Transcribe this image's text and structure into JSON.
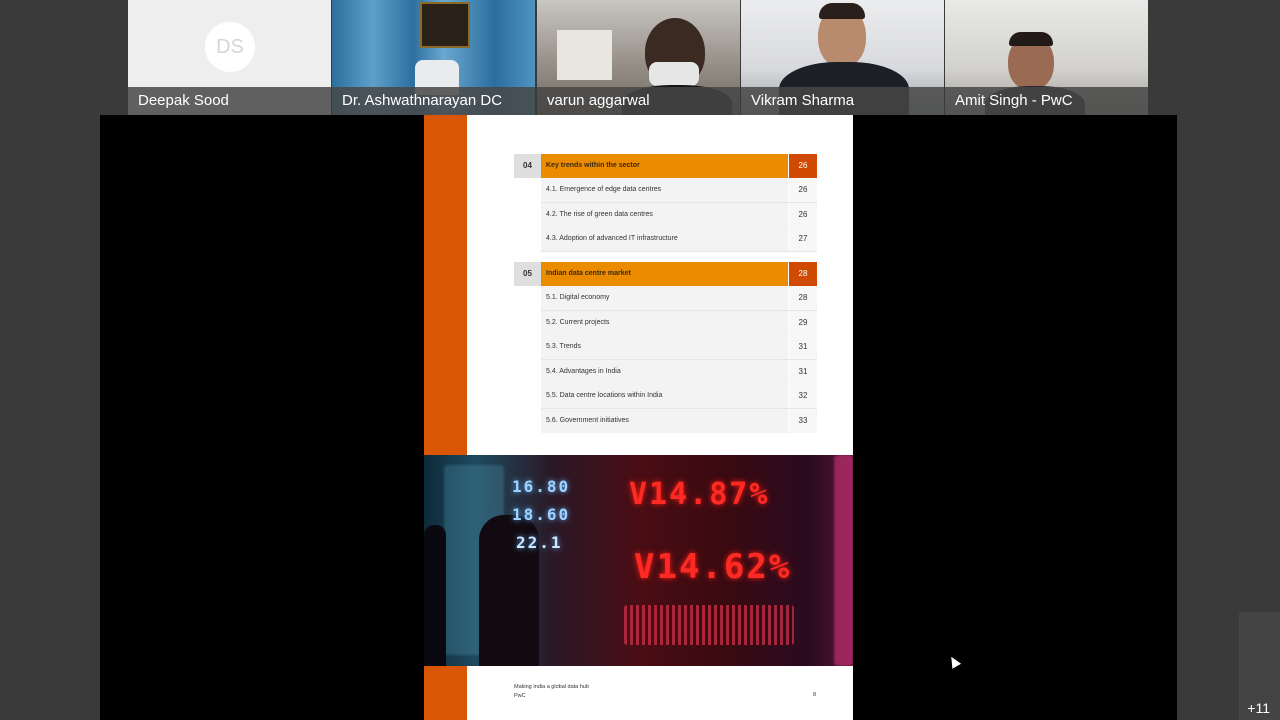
{
  "participants": [
    {
      "name": "Deepak Sood",
      "initials": "DS"
    },
    {
      "name": "Dr. Ashwathnarayan DC"
    },
    {
      "name": "varun aggarwal"
    },
    {
      "name": "Vikram Sharma"
    },
    {
      "name": "Amit Singh - PwC"
    }
  ],
  "overflow_count": "+11",
  "doc": {
    "sections": [
      {
        "num": "04",
        "title": "Key trends within the sector",
        "page": "26",
        "items": [
          {
            "label": "4.1. Emergence of edge data centres",
            "page": "26"
          },
          {
            "label": "4.2. The rise of green data centres",
            "page": "26"
          },
          {
            "label": "4.3. Adoption of advanced IT infrastructure",
            "page": "27"
          }
        ]
      },
      {
        "num": "05",
        "title": "Indian data centre market",
        "page": "28",
        "items": [
          {
            "label": "5.1. Digital economy",
            "page": "28"
          },
          {
            "label": "5.2. Current projects",
            "page": "29"
          },
          {
            "label": "5.3. Trends",
            "page": "31"
          },
          {
            "label": "5.4. Advantages in India",
            "page": "31"
          },
          {
            "label": "5.5. Data centre locations within India",
            "page": "32"
          },
          {
            "label": "5.6. Government initiatives",
            "page": "33"
          }
        ]
      }
    ],
    "footer_title": "Making India a global data hub",
    "footer_brand": "PwC",
    "footer_page": "8",
    "photo_text": [
      "16.80",
      "18.60",
      "22.1",
      "V14.87%",
      "V14.62%"
    ]
  },
  "colors": {
    "orange_bar": "#d85604",
    "section_title": "#eb8c00",
    "section_page": "#d04a02"
  }
}
